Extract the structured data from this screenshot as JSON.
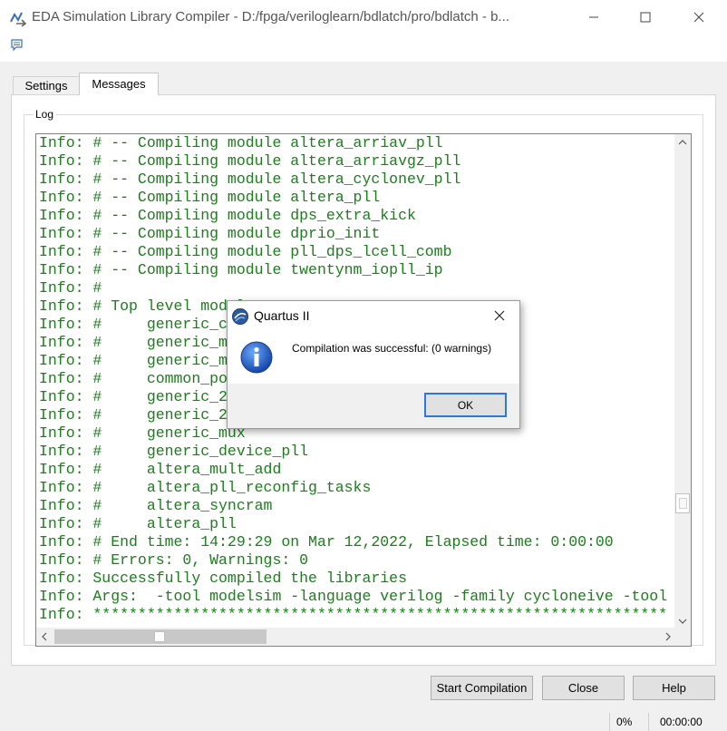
{
  "window": {
    "title": "EDA Simulation Library Compiler - D:/fpga/veriloglearn/bdlatch/pro/bdlatch - b...",
    "app_icon": "eda-compiler-icon",
    "controls": {
      "minimize": "─",
      "maximize": "☐",
      "close": "✕"
    }
  },
  "toolbar": {
    "icon": "message-icon"
  },
  "tabs": [
    {
      "label": "Settings",
      "active": false
    },
    {
      "label": "Messages",
      "active": true
    }
  ],
  "log": {
    "group_label": "Log",
    "lines": [
      "Info: # -- Compiling module altera_arriav_pll",
      "Info: # -- Compiling module altera_arriavgz_pll",
      "Info: # -- Compiling module altera_cyclonev_pll",
      "Info: # -- Compiling module altera_pll",
      "Info: # -- Compiling module dps_extra_kick",
      "Info: # -- Compiling module dprio_init",
      "Info: # -- Compiling module pll_dps_lcell_comb",
      "Info: # -- Compiling module twentynm_iopll_ip",
      "Info: #",
      "Info: # Top level modules:",
      "Info: #     generic_c",
      "Info: #     generic_m",
      "Info: #     generic_m",
      "Info: #     common_po",
      "Info: #     generic_2",
      "Info: #     generic_2",
      "Info: #     generic_mux",
      "Info: #     generic_device_pll",
      "Info: #     altera_mult_add",
      "Info: #     altera_pll_reconfig_tasks",
      "Info: #     altera_syncram",
      "Info: #     altera_pll",
      "Info: # End time: 14:29:29 on Mar 12,2022, Elapsed time: 0:00:00",
      "Info: # Errors: 0, Warnings: 0",
      "Info: Successfully compiled the libraries",
      "Info: Args:  -tool modelsim -language verilog -family cycloneive -tool",
      "Info: ****************************************************************"
    ]
  },
  "dialog": {
    "title": "Quartus II",
    "message": "Compilation was successful: (0 warnings)",
    "ok_label": "OK",
    "close_glyph": "✕"
  },
  "buttons": {
    "start_compilation": "Start Compilation",
    "close": "Close",
    "help": "Help"
  },
  "status": {
    "percent": "0%",
    "elapsed": "00:00:00"
  },
  "colors": {
    "log_text": "#1a7f1a",
    "dialog_ok_border": "#2b79d8"
  }
}
